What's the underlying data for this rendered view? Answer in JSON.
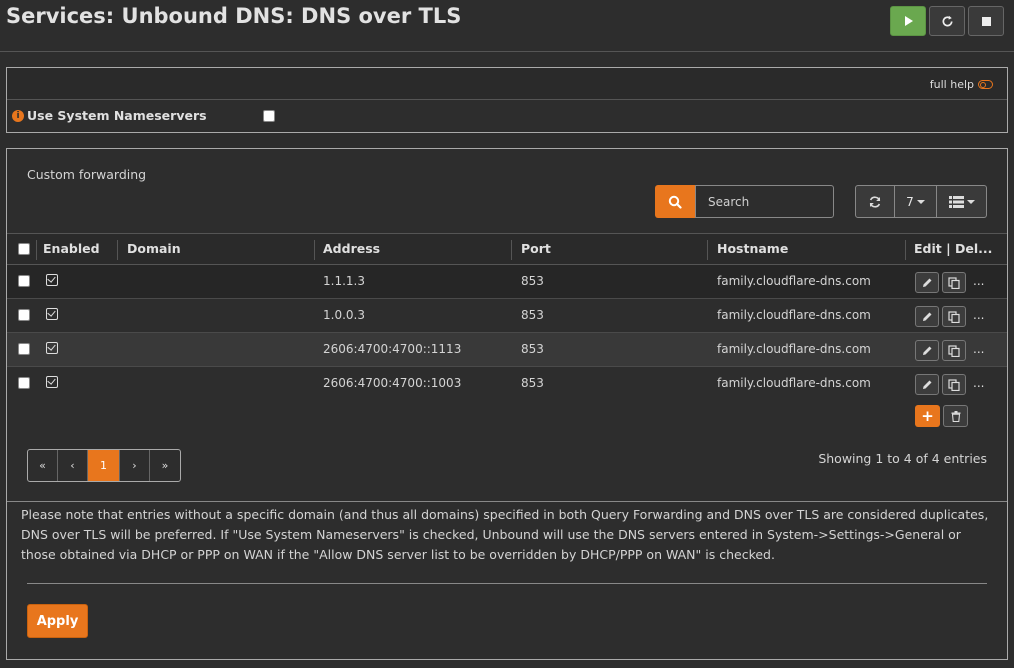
{
  "page": {
    "title": "Services: Unbound DNS: DNS over TLS"
  },
  "top_buttons": {
    "start_icon": "play-icon",
    "restart_icon": "refresh-icon",
    "stop_icon": "stop-icon"
  },
  "general": {
    "full_help_label": "full help",
    "use_system_ns_label": "Use System Nameservers",
    "use_system_ns_checked": false
  },
  "forwarding": {
    "title": "Custom forwarding",
    "search_placeholder": "Search",
    "row_count": "7",
    "columns": {
      "enabled": "Enabled",
      "domain": "Domain",
      "address": "Address",
      "port": "Port",
      "hostname": "Hostname",
      "commands": "Edit | Del..."
    },
    "rows": [
      {
        "enabled": true,
        "domain": "",
        "address": "1.1.1.3",
        "port": "853",
        "hostname": "family.cloudflare-dns.com"
      },
      {
        "enabled": true,
        "domain": "",
        "address": "1.0.0.3",
        "port": "853",
        "hostname": "family.cloudflare-dns.com"
      },
      {
        "enabled": true,
        "domain": "",
        "address": "2606:4700:4700::1113",
        "port": "853",
        "hostname": "family.cloudflare-dns.com"
      },
      {
        "enabled": true,
        "domain": "",
        "address": "2606:4700:4700::1003",
        "port": "853",
        "hostname": "family.cloudflare-dns.com"
      }
    ],
    "row_more": "...",
    "pagination": {
      "first": "«",
      "prev": "‹",
      "current": "1",
      "next": "›",
      "last": "»"
    },
    "showing_text": "Showing 1 to 4 of 4 entries"
  },
  "note": "Please note that entries without a specific domain (and thus all domains) specified in both Query Forwarding and DNS over TLS are considered duplicates, DNS over TLS will be preferred. If \"Use System Nameservers\" is checked, Unbound will use the DNS servers entered in System->Settings->General or those obtained via DHCP or PPP on WAN if the \"Allow DNS server list to be overridden by DHCP/PPP on WAN\" is checked.",
  "apply_label": "Apply",
  "colors": {
    "accent": "#e8761d",
    "start_button": "#6aa84f",
    "background": "#2d2d2d"
  }
}
